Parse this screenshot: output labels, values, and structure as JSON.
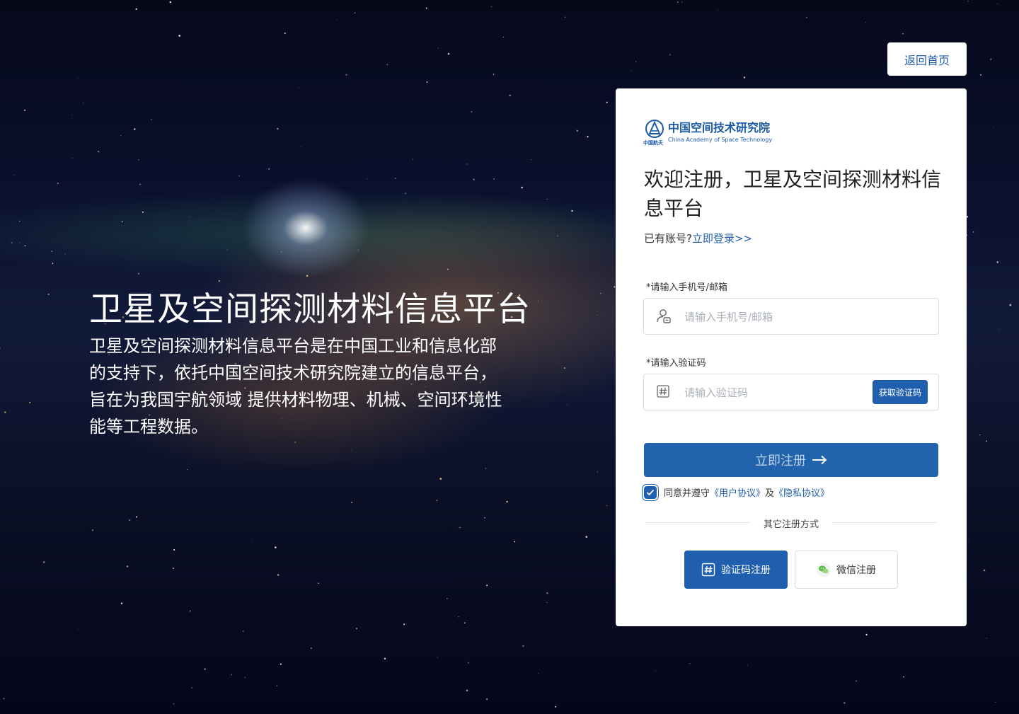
{
  "header": {
    "back_home": "返回首页"
  },
  "hero": {
    "title": "卫星及空间探测材料信息平台",
    "description": "卫星及空间探测材料信息平台是在中国工业和信息化部的支持下，依托中国空间技术研究院建立的信息平台，旨在为我国宇航领域 提供材料物理、机械、空间环境性能等工程数据。"
  },
  "card": {
    "logo": {
      "cn": "中国空间技术研究院",
      "en": "China Academy of Space Technology",
      "mark": "中国航天"
    },
    "welcome": "欢迎注册，卫星及空间探测材料信息平台",
    "have_account": "已有账号?",
    "login_link": "立即登录>>",
    "phone": {
      "label": "*请输入手机号/邮箱",
      "placeholder": "请输入手机号/邮箱",
      "value": ""
    },
    "code": {
      "label": "*请输入验证码",
      "placeholder": "请输入验证码",
      "value": "",
      "get_code": "获取验证码"
    },
    "submit": "立即注册",
    "agree": {
      "checked": true,
      "text": "同意并遵守",
      "user_agreement": "《用户协议》",
      "and": "及",
      "privacy": "《隐私协议》"
    },
    "other_methods": "其它注册方式",
    "methods": {
      "code": "验证码注册",
      "wechat": "微信注册"
    }
  },
  "colors": {
    "primary": "#1f5fae",
    "card_bg": "#ffffff"
  }
}
